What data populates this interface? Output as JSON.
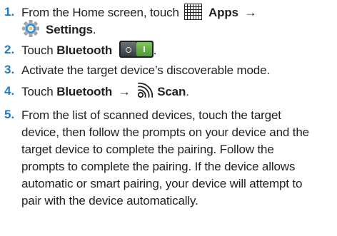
{
  "steps": [
    {
      "number": "1.",
      "line1_prefix": "From the Home screen, touch",
      "apps_label": "Apps",
      "arrow": "→",
      "settings_label": "Settings",
      "period": "."
    },
    {
      "number": "2.",
      "prefix": "Touch",
      "bluetooth_label": "Bluetooth",
      "period": "."
    },
    {
      "number": "3.",
      "text": "Activate the target device’s discoverable mode."
    },
    {
      "number": "4.",
      "prefix": "Touch",
      "bluetooth_label": "Bluetooth",
      "arrow": "→",
      "scan_label": "Scan",
      "period": "."
    },
    {
      "number": "5.",
      "lines": [
        "From the list of scanned devices, touch the target",
        "device, then follow the prompts on your device and the",
        "target device to complete the pairing. Follow the",
        "prompts to complete the pairing. If the device allows",
        "automatic or smart pairing, your device will attempt to",
        "pair with the device automatically."
      ]
    }
  ],
  "icons": {
    "apps": "apps-grid-icon",
    "settings": "settings-gear-icon",
    "toggle": "bluetooth-toggle-icon",
    "scan": "scan-icon"
  },
  "colors": {
    "number": "#1f7abf",
    "text": "#231f20",
    "toggle_on": "#6fba4c",
    "gear": "#3a8fd0"
  }
}
